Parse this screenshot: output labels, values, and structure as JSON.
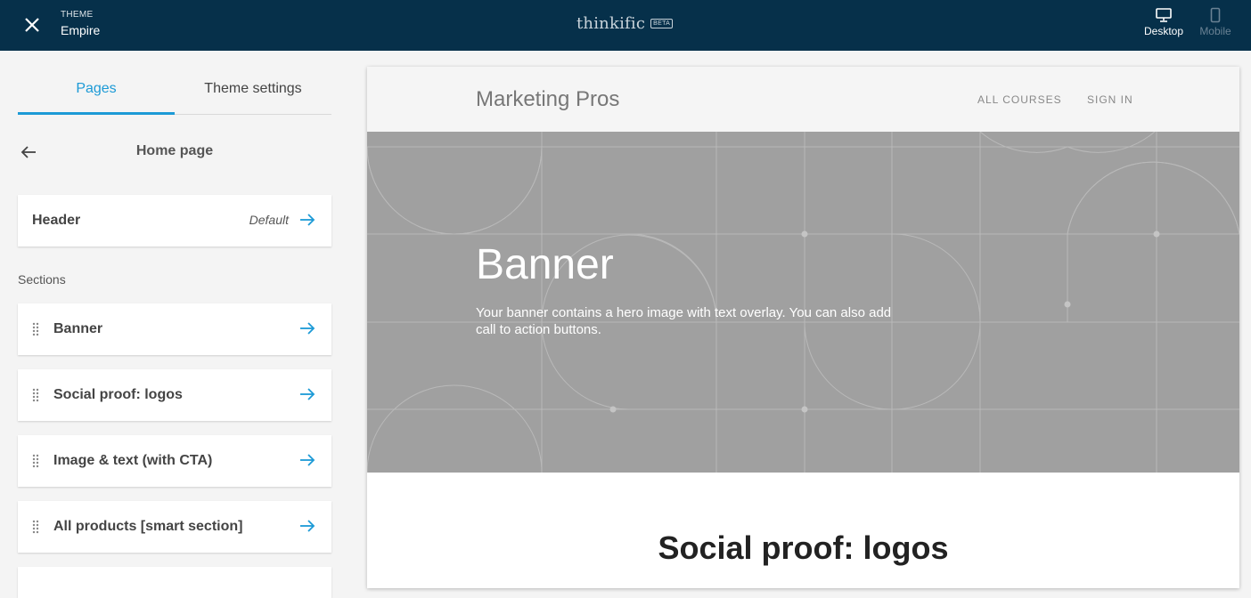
{
  "topbar": {
    "theme_label": "THEME",
    "theme_name": "Empire",
    "brand": "thinkific",
    "brand_badge": "BETA",
    "devices": [
      {
        "label": "Desktop",
        "icon": "desktop-icon",
        "active": true
      },
      {
        "label": "Mobile",
        "icon": "mobile-icon",
        "active": false
      }
    ]
  },
  "sidebar": {
    "tabs": [
      {
        "label": "Pages",
        "active": true
      },
      {
        "label": "Theme settings",
        "active": false
      }
    ],
    "page_title": "Home page",
    "header_card": {
      "label": "Header",
      "status": "Default"
    },
    "sections_label": "Sections",
    "sections": [
      {
        "label": "Banner"
      },
      {
        "label": "Social proof: logos"
      },
      {
        "label": "Image & text (with CTA)"
      },
      {
        "label": "All products [smart section]"
      }
    ]
  },
  "preview": {
    "site_title": "Marketing Pros",
    "nav": [
      "ALL COURSES",
      "SIGN IN"
    ],
    "banner_title": "Banner",
    "banner_description": "Your banner contains a hero image with text overlay. You can also add call to action buttons.",
    "next_section_title": "Social proof: logos"
  },
  "colors": {
    "topbar": "#06304a",
    "accent": "#1c9ad6",
    "banner": "#a0a0a0"
  }
}
